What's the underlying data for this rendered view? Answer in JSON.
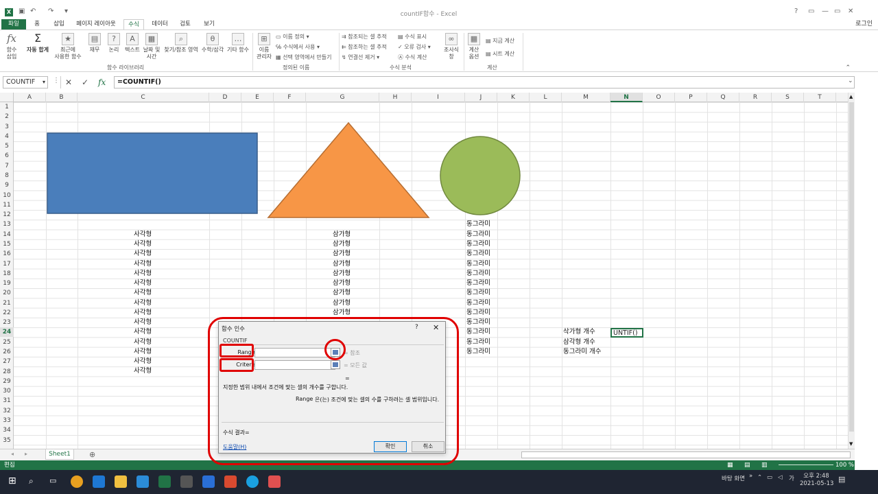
{
  "app": {
    "title": "countIF함수 - Excel",
    "login": "로그인"
  },
  "qat": {
    "undo": "↶",
    "redo": "↷",
    "more": "▾"
  },
  "window": {
    "help": "?",
    "min": "—",
    "restore": "▭",
    "close": "✕"
  },
  "tabs": [
    "파일",
    "홈",
    "삽입",
    "페이지 레이아웃",
    "수식",
    "데이터",
    "검토",
    "보기"
  ],
  "ribbon": {
    "insert_function": "함수\n삽입",
    "autosum": "자동 합계",
    "recent": "최근에\n사용한 함수",
    "financial": "재무",
    "logical": "논리",
    "text": "텍스트",
    "datetime": "날짜 및\n시간",
    "lookup": "찾기/참조 영역",
    "math": "수학/삼각",
    "more": "기타 함수",
    "name_manager": "이름\n관리자",
    "define_name": "이름 정의",
    "use_in_formula": "수식에서 사용",
    "create_from_sel": "선택 영역에서 만들기",
    "trace_precedents": "참조되는 셀 추적",
    "trace_dependents": "참조하는 셀 추적",
    "remove_arrows": "연결선 제거",
    "show_formulas": "수식 표시",
    "error_check": "오류 검사",
    "evaluate": "수식 계산",
    "watch": "조사식\n창",
    "calc_options": "계산\n옵션",
    "calc_now": "지금 계산",
    "calc_sheet": "시트 계산",
    "group_library": "함수 라이브러리",
    "group_names": "정의된 이름",
    "group_audit": "수식 분석",
    "group_calc": "계산"
  },
  "formula_bar": {
    "name_box": "COUNTIF",
    "formula": "=COUNTIF()"
  },
  "columns": [
    "A",
    "B",
    "C",
    "D",
    "E",
    "F",
    "G",
    "H",
    "I",
    "J",
    "K",
    "L",
    "M",
    "N",
    "O",
    "P",
    "Q",
    "R",
    "S",
    "T"
  ],
  "rows": [
    "1",
    "2",
    "3",
    "4",
    "5",
    "6",
    "7",
    "8",
    "9",
    "10",
    "11",
    "12",
    "13",
    "14",
    "15",
    "16",
    "17",
    "18",
    "19",
    "20",
    "21",
    "22",
    "23",
    "24",
    "25",
    "26",
    "27",
    "28",
    "29",
    "30",
    "31",
    "32",
    "33",
    "34",
    "35"
  ],
  "cells": {
    "rect": "사각형",
    "tri": "삼가형",
    "circle": "동그라미",
    "m24": "삭가형 개수",
    "m25": "삼각형 개수",
    "m26": "동그라미 개수",
    "n24": "UNTIF()"
  },
  "shapes": {
    "rect_color": "#4a7ebb",
    "tri_color": "#f79646",
    "circle_color": "#9bbb59"
  },
  "sheet": {
    "name": "Sheet1",
    "add": "⊕"
  },
  "status": {
    "mode": "편집",
    "zoom": "100 %"
  },
  "dialog": {
    "title": "함수 인수",
    "help": "?",
    "close": "✕",
    "func": "COUNTIF",
    "range_label": "Range",
    "criteria_label": "Criteria",
    "range_hint": "= 참조",
    "criteria_hint": "= 모든 값",
    "equals": "=",
    "desc": "지정한 범위 내에서 조건에 맞는 셀의 개수를 구합니다.",
    "arg_desc_name": "Range",
    "arg_desc": "은(는) 조건에 맞는 셀의 수를 구하려는 셀 범위입니다.",
    "result": "수식 결과=",
    "help_link": "도움말(H)",
    "ok": "확인",
    "cancel": "취소"
  },
  "taskbar": {
    "desktop": "바탕 화면",
    "ime": "가",
    "time": "오후 2:48",
    "date": "2021-05-13"
  }
}
